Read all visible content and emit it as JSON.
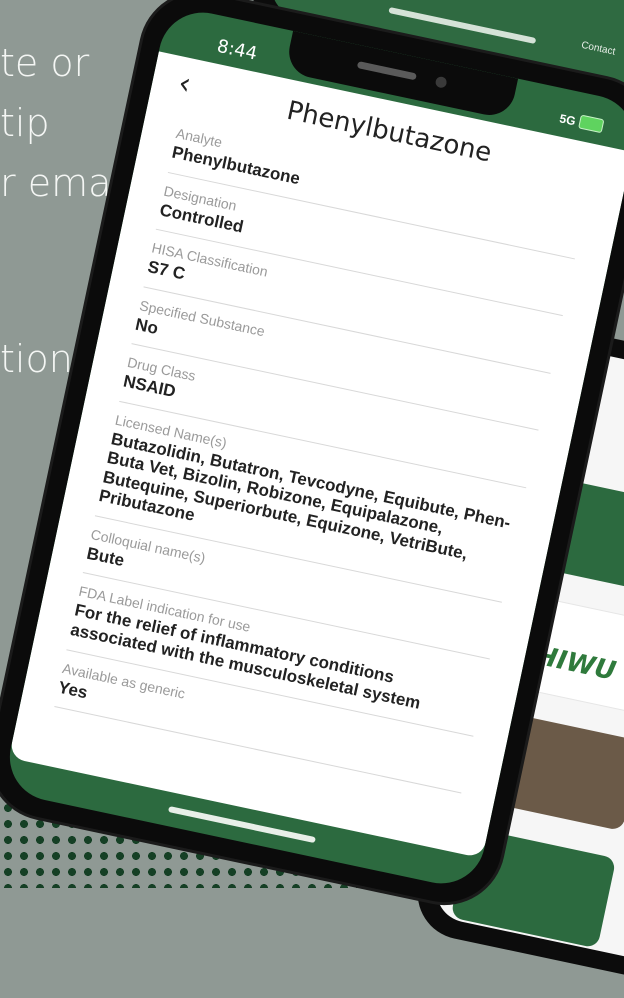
{
  "background_text": [
    "te or",
    "tip",
    "r email",
    "tions"
  ],
  "top_phone": {
    "label": "Contact"
  },
  "right_phone": {
    "logo": "HIWU"
  },
  "phone": {
    "status": {
      "time": "8:44",
      "network": "5G"
    },
    "header": {
      "back_icon": "chevron-left-icon",
      "title": "Phenylbutazone"
    },
    "fields": [
      {
        "label": "Analyte",
        "value": "Phenylbutazone"
      },
      {
        "label": "Designation",
        "value": "Controlled"
      },
      {
        "label": "HISA Classification",
        "value": "S7 C"
      },
      {
        "label": "Specified Substance",
        "value": "No"
      },
      {
        "label": "Drug Class",
        "value": "NSAID"
      },
      {
        "label": "Licensed Name(s)",
        "value": "Butazolidin, Butatron, Tevcodyne, Equibute, Phen-Buta Vet, Bizolin, Robizone, Equipalazone, Butequine, Superiorbute, Equizone, VetriBute, Pributazone"
      },
      {
        "label": "Colloquial name(s)",
        "value": "Bute"
      },
      {
        "label": "FDA Label indication for use",
        "value": "For the relief of inflammatory conditions associated with the musculoskeletal system"
      },
      {
        "label": "Available as generic",
        "value": "Yes"
      }
    ]
  },
  "colors": {
    "brand_green": "#2c6a3f",
    "background": "#8f9994",
    "dots": "#0f3b1f"
  }
}
